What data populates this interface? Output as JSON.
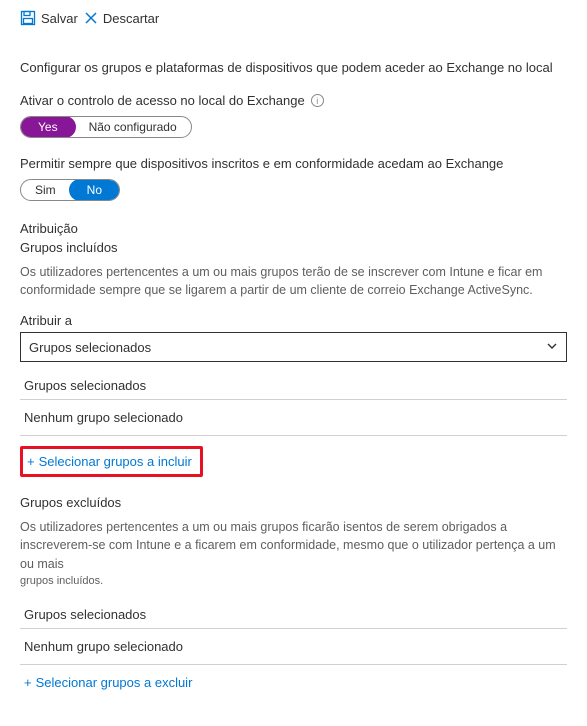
{
  "toolbar": {
    "save": "Salvar",
    "discard": "Descartar"
  },
  "intro": "Configurar os grupos e plataformas de dispositivos que podem aceder ao Exchange no local",
  "enableControl": {
    "label": "Ativar o controlo de acesso no local do Exchange",
    "yes": "Yes",
    "no": "Não configurado"
  },
  "allowCompliant": {
    "label": "Permitir sempre que dispositivos inscritos e em conformidade acedam ao Exchange",
    "yes": "Sim",
    "no": "No"
  },
  "assignment": {
    "heading": "Atribuição",
    "included": {
      "heading": "Grupos incluídos",
      "desc": "Os utilizadores pertencentes a um ou mais grupos terão de se inscrever com Intune e ficar em conformidade sempre que se ligarem a partir de um cliente de correio Exchange ActiveSync.",
      "assignToLabel": "Atribuir a",
      "assignToValue": "Grupos selecionados",
      "selectedHeader": "Grupos selecionados",
      "noneSelected": "Nenhum grupo selecionado",
      "addLink": "Selecionar grupos a incluir"
    },
    "excluded": {
      "heading": "Grupos excluídos",
      "desc": "Os utilizadores pertencentes a um ou mais grupos ficarão isentos de serem obrigados a inscreverem-se com Intune e a ficarem em conformidade, mesmo que o utilizador pertença a um ou mais",
      "descNote": "grupos incluídos.",
      "selectedHeader": "Grupos selecionados",
      "noneSelected": "Nenhum grupo selecionado",
      "addLink": "Selecionar grupos a excluir"
    }
  }
}
